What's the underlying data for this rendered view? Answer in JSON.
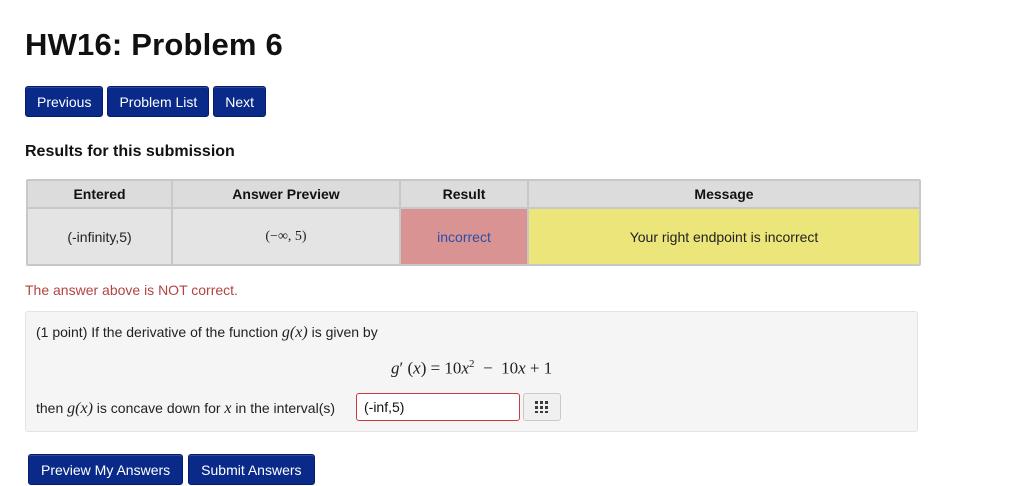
{
  "page": {
    "title": "HW16: Problem 6"
  },
  "nav": {
    "previous": "Previous",
    "problem_list": "Problem List",
    "next": "Next"
  },
  "results": {
    "heading": "Results for this submission",
    "columns": [
      "Entered",
      "Answer Preview",
      "Result",
      "Message"
    ],
    "row": {
      "entered": "(-infinity,5)",
      "preview": "(−∞, 5)",
      "result": "incorrect",
      "message": "Your right endpoint is incorrect"
    },
    "status": "The answer above is NOT correct."
  },
  "problem": {
    "intro_prefix": "(1 point) If the derivative of the function ",
    "fn": "g(x)",
    "intro_suffix": " is given by",
    "ask_prefix": "then ",
    "ask_middle": " is concave down for ",
    "var": "x",
    "ask_suffix": " in the interval(s)",
    "answer_value": "(-inf,5)"
  },
  "actions": {
    "preview": "Preview My Answers",
    "submit": "Submit Answers"
  },
  "colors": {
    "button_blue": "#0a2a8a",
    "incorrect_bg": "#d99393",
    "message_bg": "#ece57a",
    "error_text": "#b2443f"
  },
  "icons": {
    "palette": "equation-palette-icon"
  }
}
